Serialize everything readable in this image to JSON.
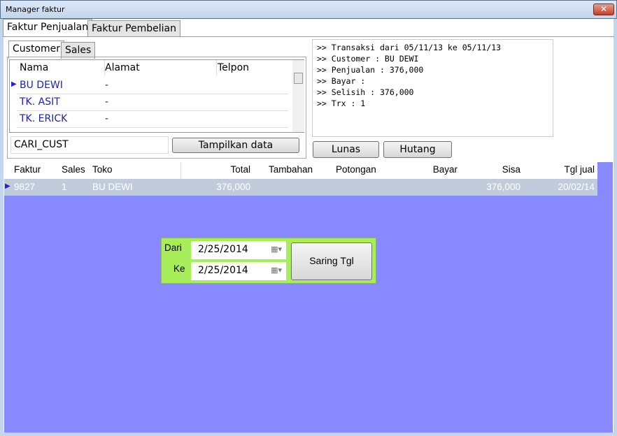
{
  "window": {
    "title": "Manager faktur",
    "close": "✕"
  },
  "main_tabs": [
    {
      "label": "Faktur Penjualan"
    },
    {
      "label": "Faktur Pembelian"
    }
  ],
  "sub_tabs": [
    {
      "label": "Customer"
    },
    {
      "label": "Sales"
    }
  ],
  "customer_grid": {
    "columns": [
      "Nama",
      "Alamat",
      "Telpon"
    ],
    "rows": [
      [
        "BU DEWI",
        "-",
        ""
      ],
      [
        "TK. ASIT",
        "-",
        ""
      ],
      [
        "TK. ERICK",
        "-",
        ""
      ]
    ]
  },
  "search": {
    "value": "CARI_CUST"
  },
  "buttons": {
    "tampilkan": "Tampilkan data",
    "lunas": "Lunas",
    "hutang": "Hutang",
    "saring": "Saring Tgl"
  },
  "info_lines": [
    ">> Transaksi dari 05/11/13 ke 05/11/13",
    ">> Customer : BU DEWI",
    ">> Penjualan : 376,000",
    ">> Bayar :",
    ">> Selisih : 376,000",
    ">> Trx : 1"
  ],
  "faktur_grid": {
    "columns": [
      "Faktur",
      "Sales",
      "Toko",
      "Total",
      "Tambahan",
      "Potongan",
      "Bayar",
      "Sisa",
      "Tgl jual"
    ],
    "rows": [
      [
        "9827",
        "1",
        "BU DEWI",
        "376,000",
        "",
        "",
        "",
        "376,000",
        "20/02/14"
      ]
    ]
  },
  "filter": {
    "dari_label": "Dari",
    "ke_label": "Ke",
    "dari": "2/25/2014",
    "ke": "2/25/2014"
  },
  "colors": {
    "lower_bg": "#8888ff",
    "filter_bg": "#a8ee5a",
    "selected_row": "#c0ccdc"
  }
}
